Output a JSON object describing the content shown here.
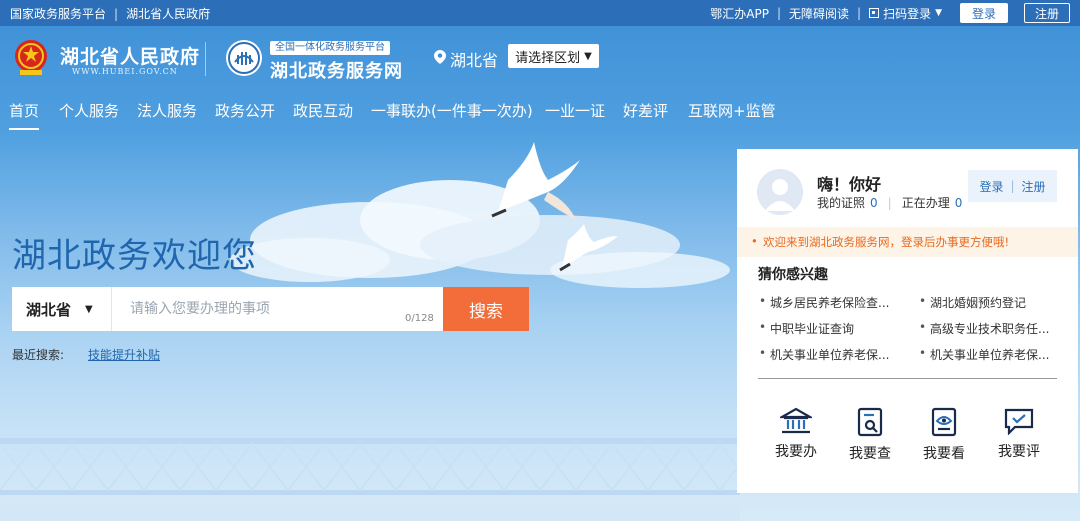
{
  "topbar": {
    "left_links": [
      "国家政务服务平台",
      "湖北省人民政府"
    ],
    "app_link": "鄂汇办APP",
    "accessibility_link": "无障碍阅读",
    "qr_login": "扫码登录",
    "login_button": "登录",
    "register_button": "注册"
  },
  "header": {
    "site_name": "湖北省人民政府",
    "site_url": "WWW.HUBEI.GOV.CN",
    "service_tag": "全国一体化政务服务平台",
    "service_name": "湖北政务服务网",
    "location": "湖北省",
    "region_select": "请选择区划"
  },
  "nav": {
    "items": [
      "首页",
      "个人服务",
      "法人服务",
      "政务公开",
      "政民互动",
      "一事联办(一件事一次办)",
      "一业一证",
      "好差评",
      "互联网+监管"
    ],
    "active_index": 0
  },
  "hero": {
    "title": "湖北政务欢迎您",
    "search_province": "湖北省",
    "search_placeholder": "请输入您要办理的事项",
    "search_counter": "0/128",
    "search_button": "搜索",
    "recent_label": "最近搜索:",
    "recent_item": "技能提升补贴"
  },
  "panel": {
    "greeting": "嗨！你好",
    "my_certs_label": "我的证照",
    "my_certs_count": "0",
    "in_progress_label": "正在办理",
    "in_progress_count": "0",
    "login": "登录",
    "register": "注册",
    "notice": "欢迎来到湖北政务服务网，登录后办事更方便哦!",
    "interest_title": "猜你感兴趣",
    "interests": [
      "城乡居民养老保险查...",
      "湖北婚姻预约登记",
      "中职毕业证查询",
      "高级专业技术职务任...",
      "机关事业单位养老保...",
      "机关事业单位养老保..."
    ],
    "quick_actions": [
      {
        "label": "我要办",
        "icon": "bank-icon"
      },
      {
        "label": "我要查",
        "icon": "search-doc-icon"
      },
      {
        "label": "我要看",
        "icon": "eye-doc-icon"
      },
      {
        "label": "我要评",
        "icon": "comment-check-icon"
      }
    ]
  },
  "colors": {
    "topbar": "#2c6fb8",
    "accent_orange": "#f26d3a",
    "link_blue": "#2c6fb8",
    "hero_title": "#1f66ad"
  }
}
